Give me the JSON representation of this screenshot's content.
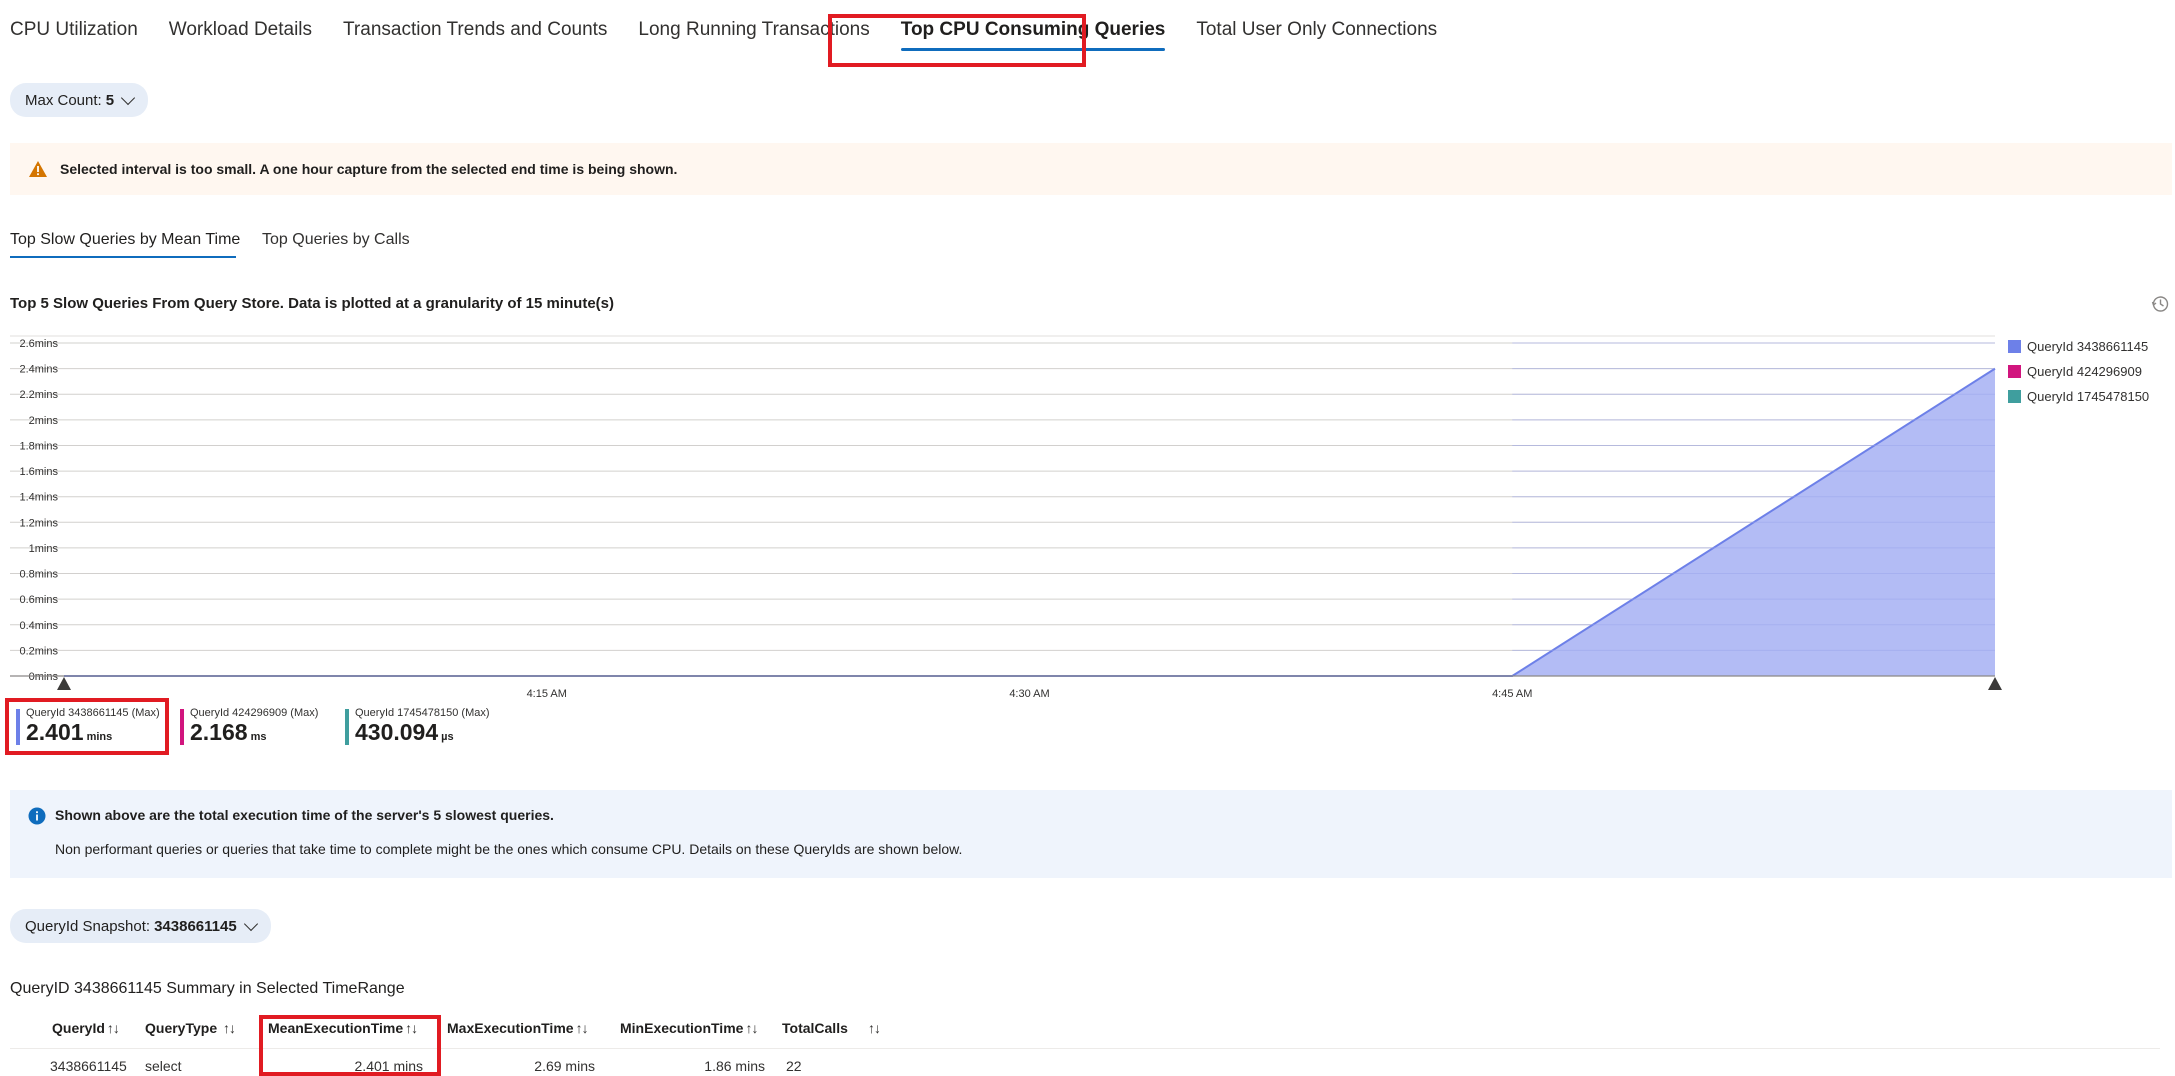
{
  "top_tabs": [
    {
      "label": "CPU Utilization"
    },
    {
      "label": "Workload Details"
    },
    {
      "label": "Transaction Trends and Counts"
    },
    {
      "label": "Long Running Transactions"
    },
    {
      "label": "Top CPU Consuming Queries",
      "active": true
    },
    {
      "label": "Total User Only Connections"
    }
  ],
  "max_count": {
    "label": "Max Count:",
    "value": "5"
  },
  "warning": {
    "text": "Selected interval is too small. A one hour capture from the selected end time is being shown.",
    "icon": "warning-icon",
    "color": "#d47500"
  },
  "sub_tabs": [
    {
      "label": "Top Slow Queries by Mean Time",
      "active": true
    },
    {
      "label": "Top Queries by Calls"
    }
  ],
  "chart_title": "Top 5 Slow Queries From Query Store. Data is plotted at a granularity of 15 minute(s)",
  "history_icon": "history-icon",
  "chart_data": {
    "type": "area",
    "title": "Top 5 Slow Queries From Query Store. Data is plotted at a granularity of 15 minute(s)",
    "y_ticks": [
      "0mins",
      "0.2mins",
      "0.4mins",
      "0.6mins",
      "0.8mins",
      "1mins",
      "1.2mins",
      "1.4mins",
      "1.6mins",
      "1.8mins",
      "2mins",
      "2.2mins",
      "2.4mins",
      "2.6mins"
    ],
    "ylim": [
      0,
      2.6
    ],
    "x_ticks": [
      "4:15 AM",
      "4:30 AM",
      "4:45 AM"
    ],
    "xlim_minutes_after_4am": [
      0,
      60
    ],
    "grid": true,
    "legend_position": "right",
    "series": [
      {
        "name": "QueryId 3438661145",
        "color": "#6d80e8",
        "fill": "#b3bcf5",
        "points": [
          [
            0,
            0
          ],
          [
            45,
            0
          ],
          [
            60,
            2.4
          ]
        ]
      },
      {
        "name": "QueryId 424296909",
        "color": "#d1157e",
        "points": []
      },
      {
        "name": "QueryId 1745478150",
        "color": "#3f9e9e",
        "points": []
      }
    ]
  },
  "metrics": [
    {
      "label": "QueryId 3438661145 (Max)",
      "value": "2.401",
      "unit": "mins",
      "color": "#6d80e8"
    },
    {
      "label": "QueryId 424296909 (Max)",
      "value": "2.168",
      "unit": "ms",
      "color": "#d1157e"
    },
    {
      "label": "QueryId 1745478150 (Max)",
      "value": "430.094",
      "unit": "µs",
      "color": "#3f9e9e"
    }
  ],
  "info": {
    "icon": "info-icon",
    "title": "Shown above are the total execution time of the server's 5 slowest queries.",
    "body": "Non performant queries or queries that take time to complete might be the ones which consume CPU. Details on these QueryIds are shown below."
  },
  "snapshot": {
    "label": "QueryId Snapshot:",
    "value": "3438661145"
  },
  "summary_title": "QueryID 3438661145 Summary in Selected TimeRange",
  "table": {
    "columns": [
      "QueryId",
      "QueryType",
      "MeanExecutionTime",
      "MaxExecutionTime",
      "MinExecutionTime",
      "TotalCalls"
    ],
    "sort_glyph": "↑↓",
    "rows": [
      [
        "3438661145",
        "select",
        "2.401 mins",
        "2.69 mins",
        "1.86 mins",
        "22"
      ]
    ]
  }
}
